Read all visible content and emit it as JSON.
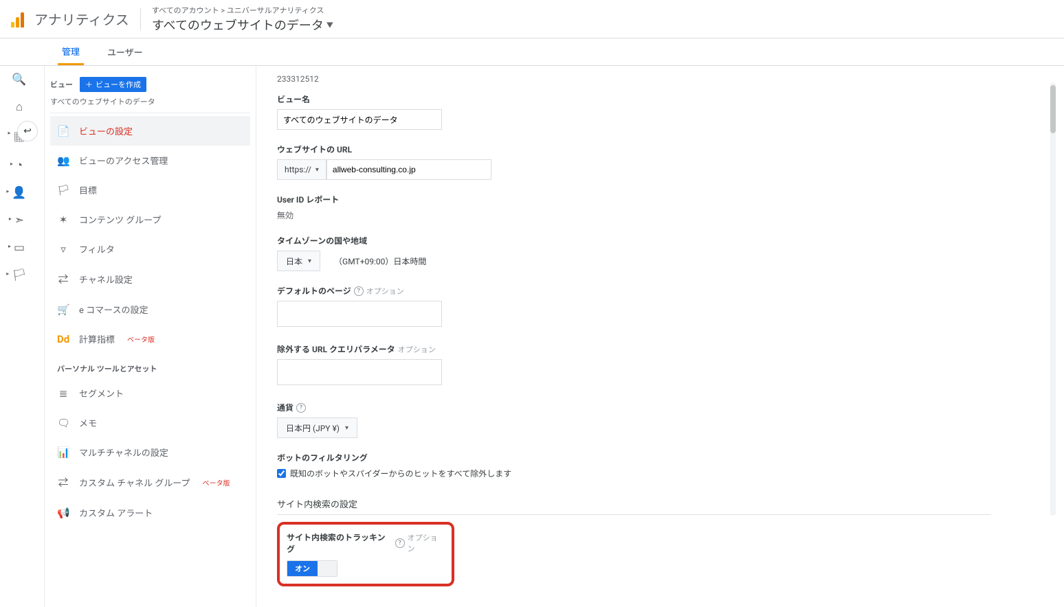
{
  "header": {
    "app_title": "アナリティクス",
    "breadcrumb_path": "すべてのアカウント > ユニバーサルアナリティクス",
    "breadcrumb_title": "すべてのウェブサイトのデータ"
  },
  "tabs": {
    "admin": "管理",
    "user": "ユーザー"
  },
  "view_panel": {
    "heading": "ビュー",
    "create_btn": "ビューを作成",
    "subtitle": "すべてのウェブサイトのデータ",
    "items": [
      {
        "icon": "📄",
        "label": "ビューの設定",
        "active": true
      },
      {
        "icon": "👥",
        "label": "ビューのアクセス管理"
      },
      {
        "icon": "🏳",
        "label": "目標"
      },
      {
        "icon": "✶",
        "label": "コンテンツ グループ"
      },
      {
        "icon": "▿",
        "label": "フィルタ"
      },
      {
        "icon": "⇄",
        "label": "チャネル設定"
      },
      {
        "icon": "🛒",
        "label": "e コマースの設定"
      },
      {
        "icon": "Dd",
        "label": "計算指標",
        "beta": "ベータ版"
      }
    ],
    "section2_title": "パーソナル ツールとアセット",
    "items2": [
      {
        "icon": "≣",
        "label": "セグメント"
      },
      {
        "icon": "🗨",
        "label": "メモ"
      },
      {
        "icon": "📊",
        "label": "マルチチャネルの設定"
      },
      {
        "icon": "⇄",
        "label": "カスタム チャネル グループ",
        "beta": "ベータ版"
      },
      {
        "icon": "📢",
        "label": "カスタム アラート"
      }
    ]
  },
  "form": {
    "view_id": "233312512",
    "view_name_label": "ビュー名",
    "view_name_value": "すべてのウェブサイトのデータ",
    "url_label": "ウェブサイトの URL",
    "protocol": "https://",
    "url_value": "allweb-consulting.co.jp",
    "userid_label": "User ID レポート",
    "userid_value": "無効",
    "tz_label": "タイムゾーンの国や地域",
    "tz_country": "日本",
    "tz_desc": "（GMT+09:00）日本時間",
    "default_page_label": "デフォルトのページ",
    "option_suffix": "オプション",
    "exclude_label": "除外する URL クエリパラメータ",
    "currency_label": "通貨",
    "currency_value": "日本円 (JPY ¥)",
    "bot_label": "ボットのフィルタリング",
    "bot_check": "既知のボットやスパイダーからのヒットをすべて除外します",
    "site_search_section": "サイト内検索の設定",
    "tracking_label": "サイト内検索のトラッキング",
    "toggle_on": "オン"
  }
}
